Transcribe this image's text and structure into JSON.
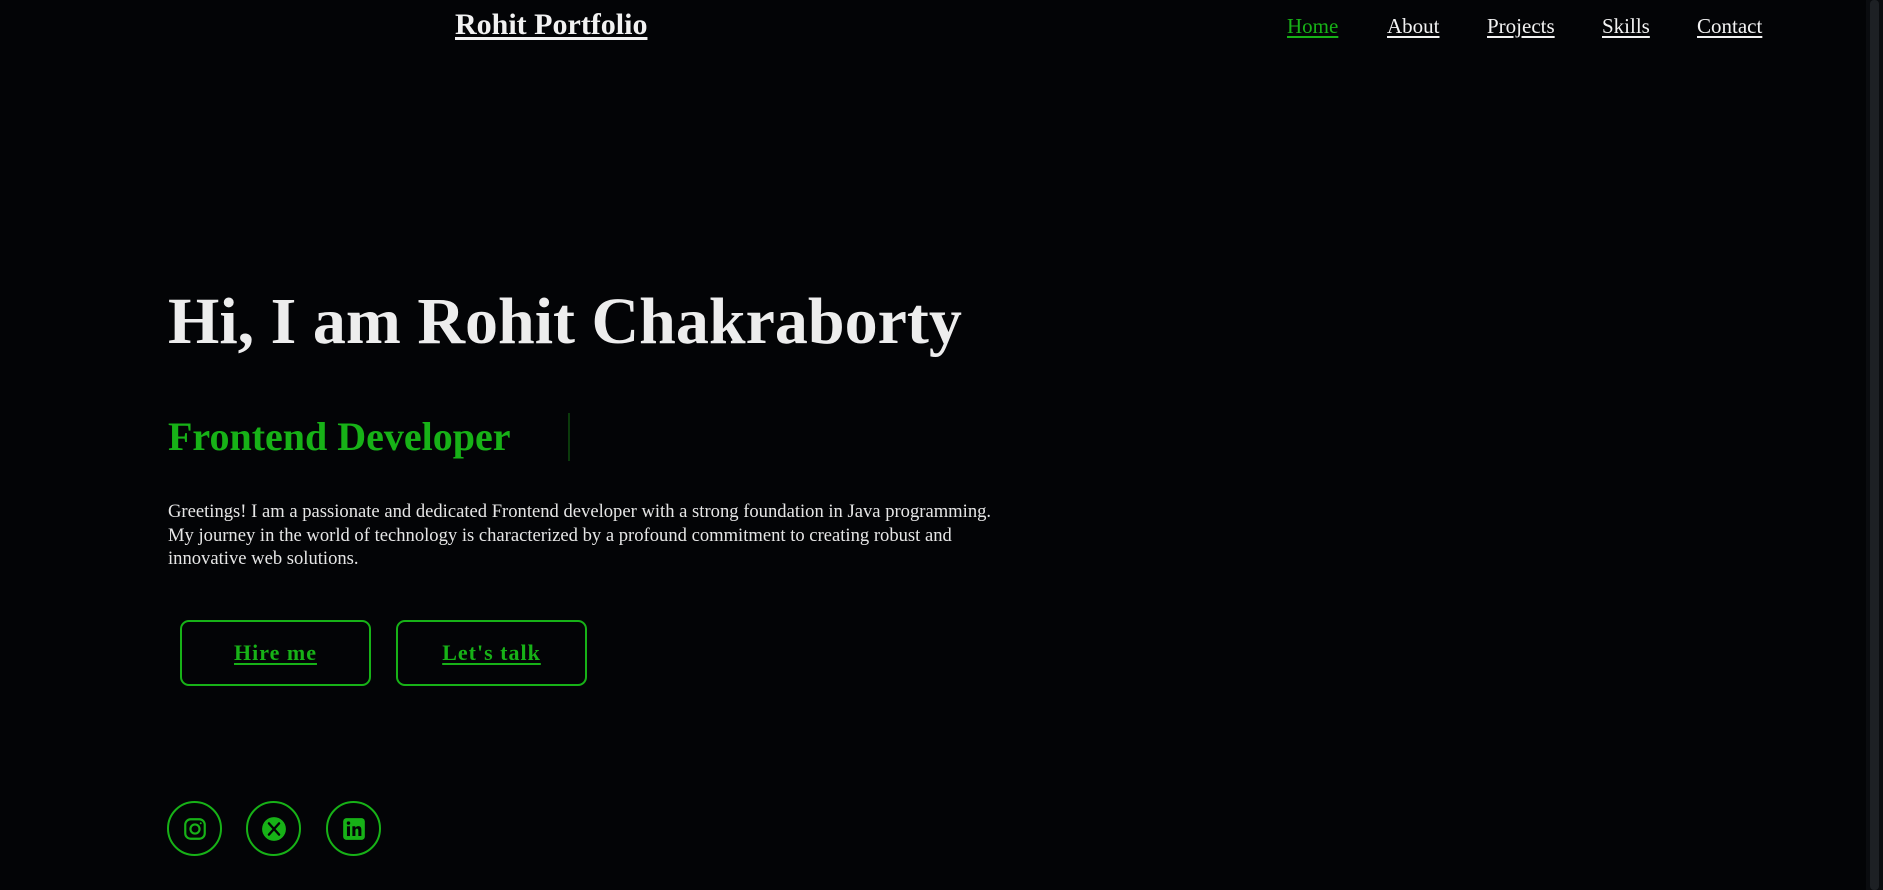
{
  "header": {
    "brand": "Rohit Portfolio",
    "nav": [
      "Home",
      "About",
      "Projects",
      "Skills",
      "Contact"
    ],
    "active_index": 0
  },
  "hero": {
    "title": "Hi, I am Rohit Chakraborty",
    "role": "Frontend Developer",
    "bio": "Greetings! I am a passionate and dedicated Frontend developer with a strong foundation in Java programming. My journey in the world of technology is characterized by a profound commitment to creating robust and innovative web solutions.",
    "buttons": {
      "hire": "Hire me",
      "talk": "Let's talk"
    }
  },
  "social": [
    {
      "icon": "instagram-icon"
    },
    {
      "icon": "x-twitter-icon"
    },
    {
      "icon": "linkedin-icon"
    }
  ],
  "colors": {
    "background": "#030406",
    "accent": "#17b217",
    "text": "#ececec"
  }
}
